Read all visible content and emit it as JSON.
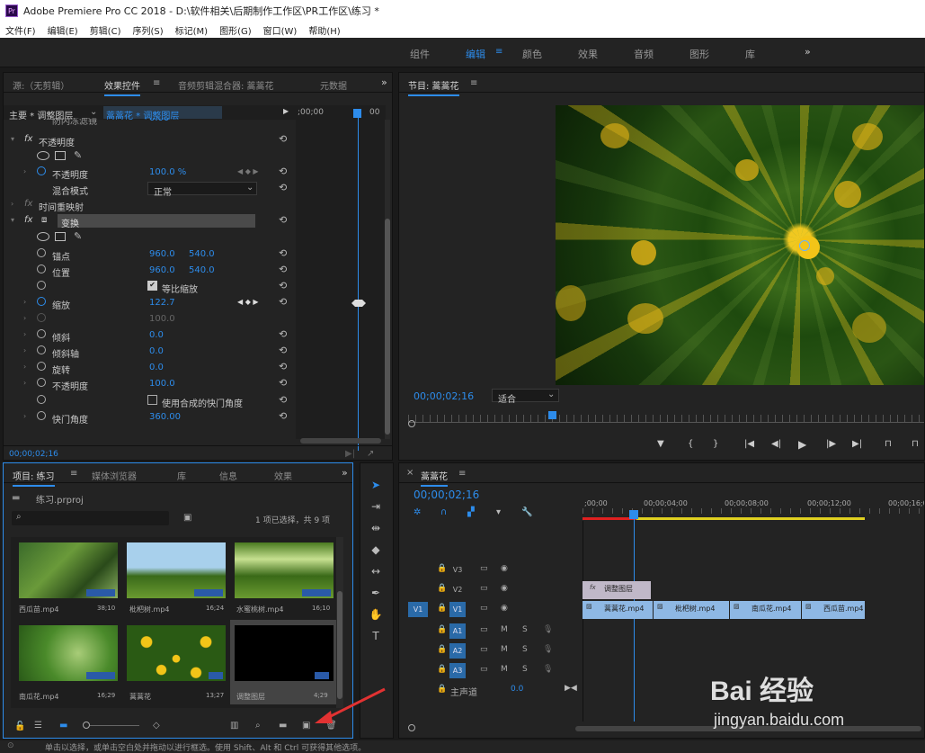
{
  "window": {
    "title": "Adobe Premiere Pro CC 2018 - D:\\软件相关\\后期制作工作区\\PR工作区\\练习 *"
  },
  "menu": [
    "文件(F)",
    "编辑(E)",
    "剪辑(C)",
    "序列(S)",
    "标记(M)",
    "图形(G)",
    "窗口(W)",
    "帮助(H)"
  ],
  "workspaces": [
    "组件",
    "编辑",
    "颜色",
    "效果",
    "音频",
    "图形",
    "库"
  ],
  "source_panel": {
    "tabs": [
      "源:（无剪辑）",
      "效果控件",
      "音频剪辑混合器: 蒿蒿花",
      "元数据"
    ],
    "master_label": "主要 * 调整图层",
    "clip_label": "蒿蒿花 * 调整图层",
    "ruler_time": ";00;00",
    "ruler_end": "00",
    "timecode": "00;00;02;16",
    "cut_row": "防闪冻滤镜",
    "rows": [
      {
        "fx": "fx",
        "name": "不透明度"
      },
      {
        "name": "不透明度",
        "v1": "100.0 %"
      },
      {
        "name": "混合模式",
        "select": "正常"
      },
      {
        "fx": "fx",
        "name": "时间重映射"
      },
      {
        "fx": "fx",
        "name": "变换"
      },
      {
        "name": "锚点",
        "v1": "960.0",
        "v2": "540.0"
      },
      {
        "name": "位置",
        "v1": "960.0",
        "v2": "540.0"
      },
      {
        "check": "等比缩放"
      },
      {
        "name": "缩放",
        "v1": "122.7"
      },
      {
        "v1": "100.0"
      },
      {
        "name": "倾斜",
        "v1": "0.0"
      },
      {
        "name": "倾斜轴",
        "v1": "0.0"
      },
      {
        "name": "旋转",
        "v1": "0.0"
      },
      {
        "name": "不透明度",
        "v1": "100.0"
      },
      {
        "check": "使用合成的快门角度"
      },
      {
        "name": "快门角度",
        "v1": "360.00"
      }
    ]
  },
  "program_panel": {
    "title": "节目: 蒿蒿花",
    "timecode": "00;00;02;16",
    "fit": "适合"
  },
  "project_panel": {
    "tabs": [
      "项目: 练习",
      "媒体浏览器",
      "库",
      "信息",
      "效果"
    ],
    "file": "练习.prproj",
    "search_placeholder": "",
    "selection": "1 项已选择，共 9 项",
    "items": [
      {
        "name": "西瓜苗.mp4",
        "dur": "38;10"
      },
      {
        "name": "枇杷树.mp4",
        "dur": "16;24"
      },
      {
        "name": "水蜜桃树.mp4",
        "dur": "16;10"
      },
      {
        "name": "南瓜花.mp4",
        "dur": "16;29"
      },
      {
        "name": "蒿蒿花",
        "dur": "13;27"
      },
      {
        "name": "调整图层",
        "dur": "4;29"
      }
    ]
  },
  "timeline": {
    "title": "蒿蒿花",
    "timecode": "00;00;02;16",
    "ruler": [
      ";00;00",
      "00;00;04;00",
      "00;00;08;00",
      "00;00;12;00",
      "00;00;16;00"
    ],
    "tracks": [
      {
        "id": "V3"
      },
      {
        "id": "V2"
      },
      {
        "id": "V1",
        "src": "V1"
      },
      {
        "id": "A1",
        "m": "M",
        "s": "S"
      },
      {
        "id": "A2",
        "m": "M",
        "s": "S"
      },
      {
        "id": "A3",
        "m": "M",
        "s": "S"
      }
    ],
    "master": {
      "label": "主声道",
      "value": "0.0"
    },
    "clips": [
      {
        "name": "调整图层",
        "track": "V2"
      },
      {
        "name": "蒿蒿花.mp4",
        "track": "V1"
      },
      {
        "name": "枇杷树.mp4",
        "track": "V1"
      },
      {
        "name": "南瓜花.mp4",
        "track": "V1"
      },
      {
        "name": "西瓜苗.mp4",
        "track": "V1"
      }
    ]
  },
  "statusbar": "单击以选择，或单击空白处并拖动以进行框选。使用 Shift、Alt 和 Ctrl 可获得其他选项。",
  "watermark": {
    "logo": "Bai 经验",
    "url": "jingyan.baidu.com"
  }
}
